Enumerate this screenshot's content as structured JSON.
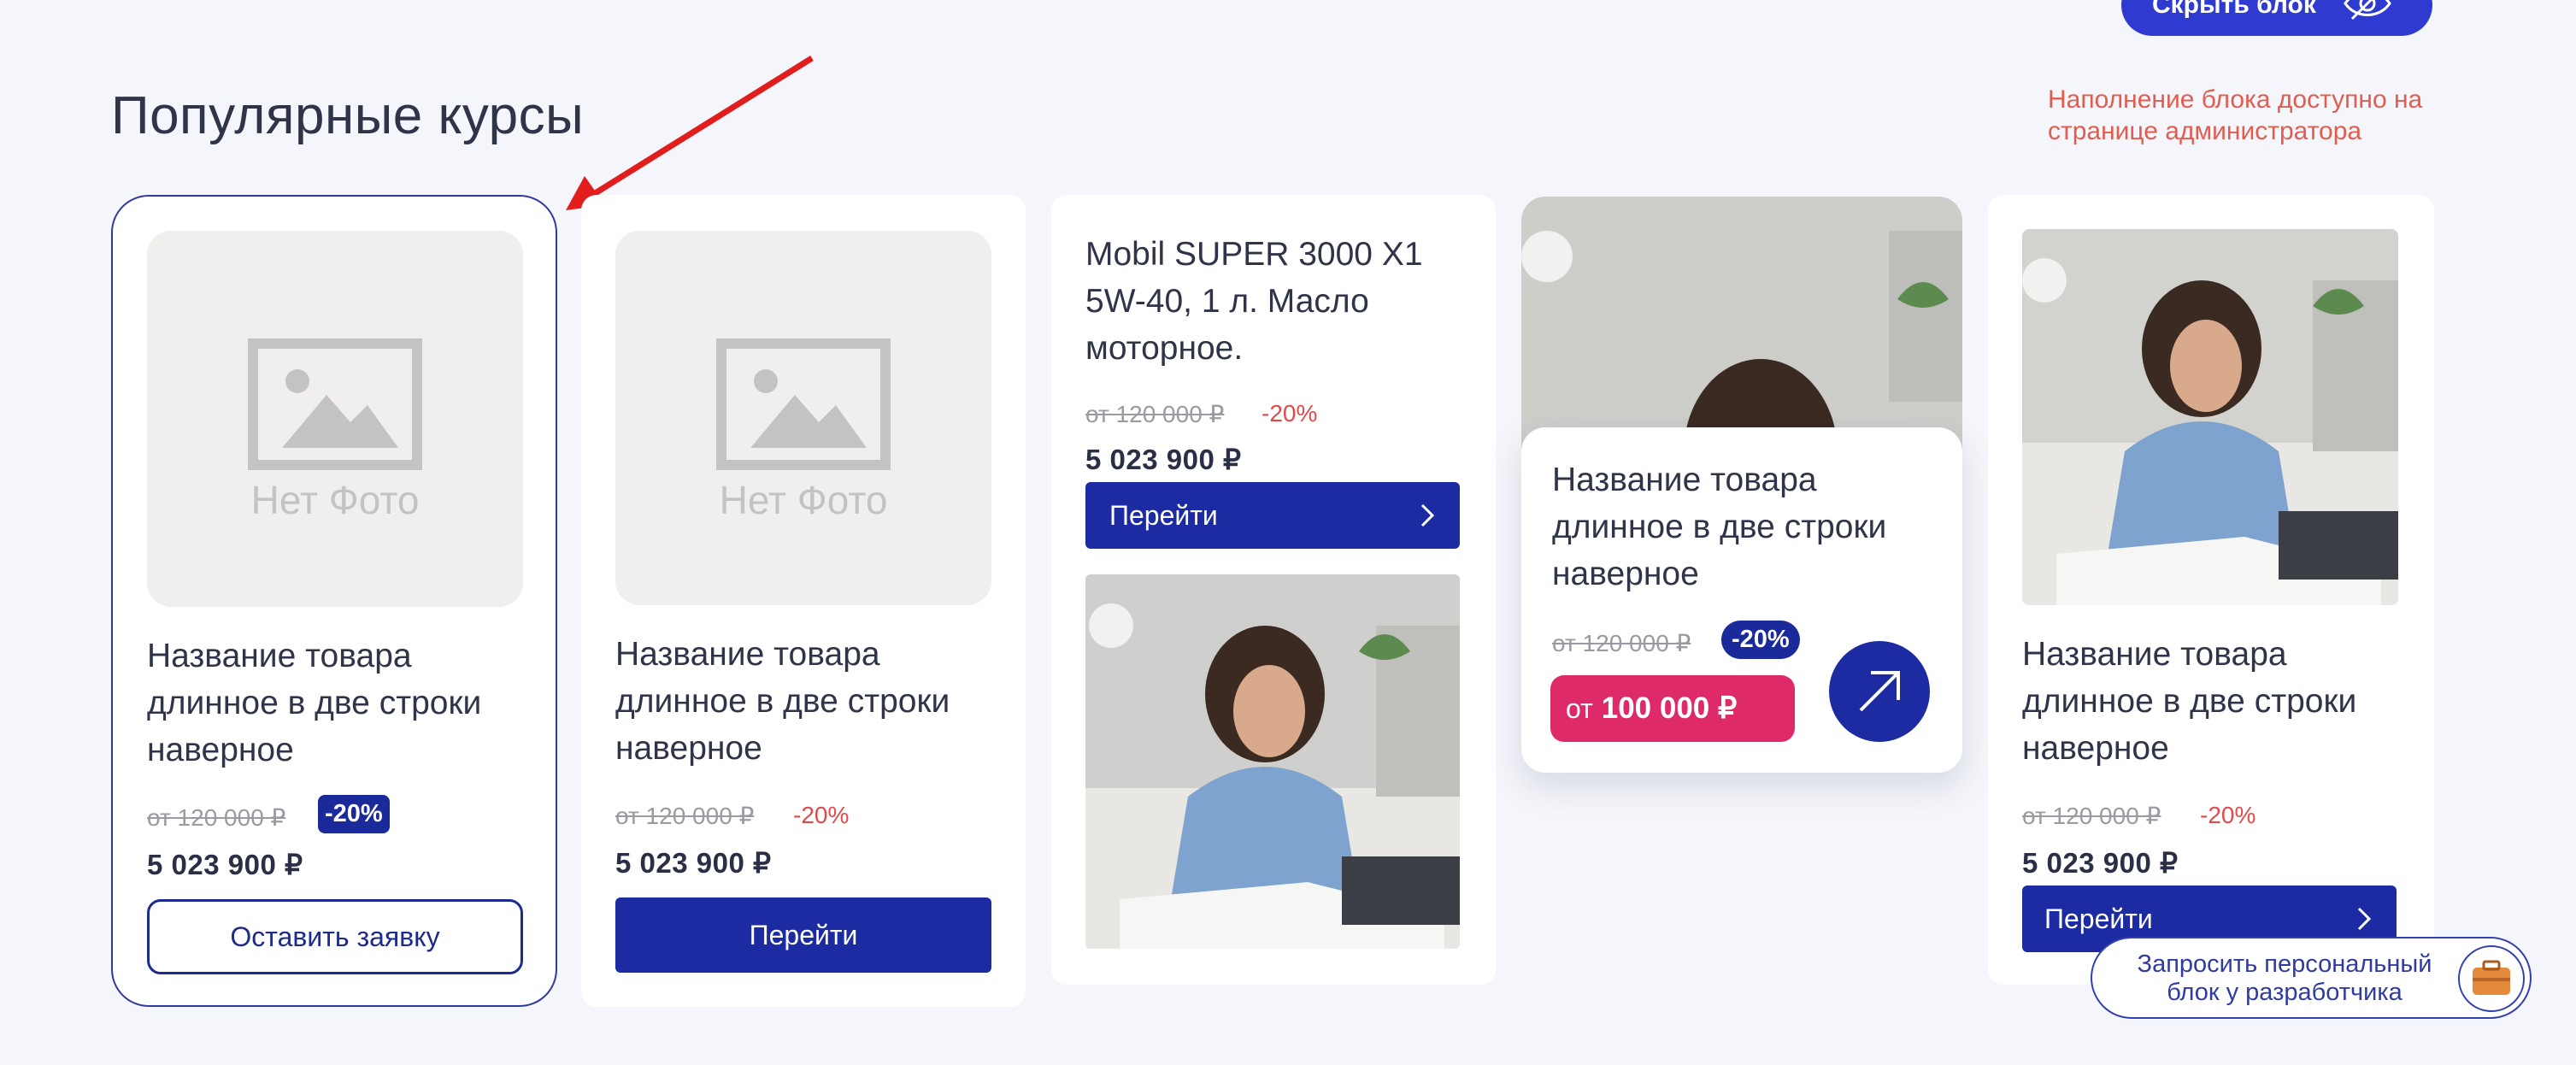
{
  "header": {
    "hide_block_label": "Скрыть блок",
    "section_title": "Популярные курсы",
    "admin_note": "Наполнение блока доступно на странице администратора"
  },
  "cards": [
    {
      "photo_placeholder": "Нет Фото",
      "name": "Название товара длинное в две строки наверное",
      "old_price": "от 120 000 ₽",
      "discount": "-20%",
      "price": "5 023 900 ₽",
      "button": "Оставить заявку"
    },
    {
      "photo_placeholder": "Нет Фото",
      "name": "Название товара длинное в две строки наверное",
      "old_price": "от 120 000 ₽",
      "discount": "-20%",
      "price": "5 023 900 ₽",
      "button": "Перейти"
    },
    {
      "name": "Mobil SUPER 3000 X1 5W-40, 1 л. Масло моторное.",
      "old_price": "от 120 000 ₽",
      "discount": "-20%",
      "price": "5 023 900 ₽",
      "button": "Перейти"
    },
    {
      "name": "Название товара длинное в две строки наверное",
      "old_price": "от 120 000 ₽",
      "discount": "-20%",
      "price_prefix": "от",
      "price": "100 000 ₽"
    },
    {
      "name": "Название товара длинное в две строки наверное",
      "old_price": "от 120 000 ₽",
      "discount": "-20%",
      "price": "5 023 900 ₽",
      "button": "Перейти"
    }
  ],
  "request_block": {
    "label": "Запросить персональный блок у разработчика"
  },
  "colors": {
    "accent_blue": "#1c2ba2",
    "accent_pink": "#df2a6a",
    "note_red": "#e25d4f",
    "background": "#f5f6fb"
  }
}
